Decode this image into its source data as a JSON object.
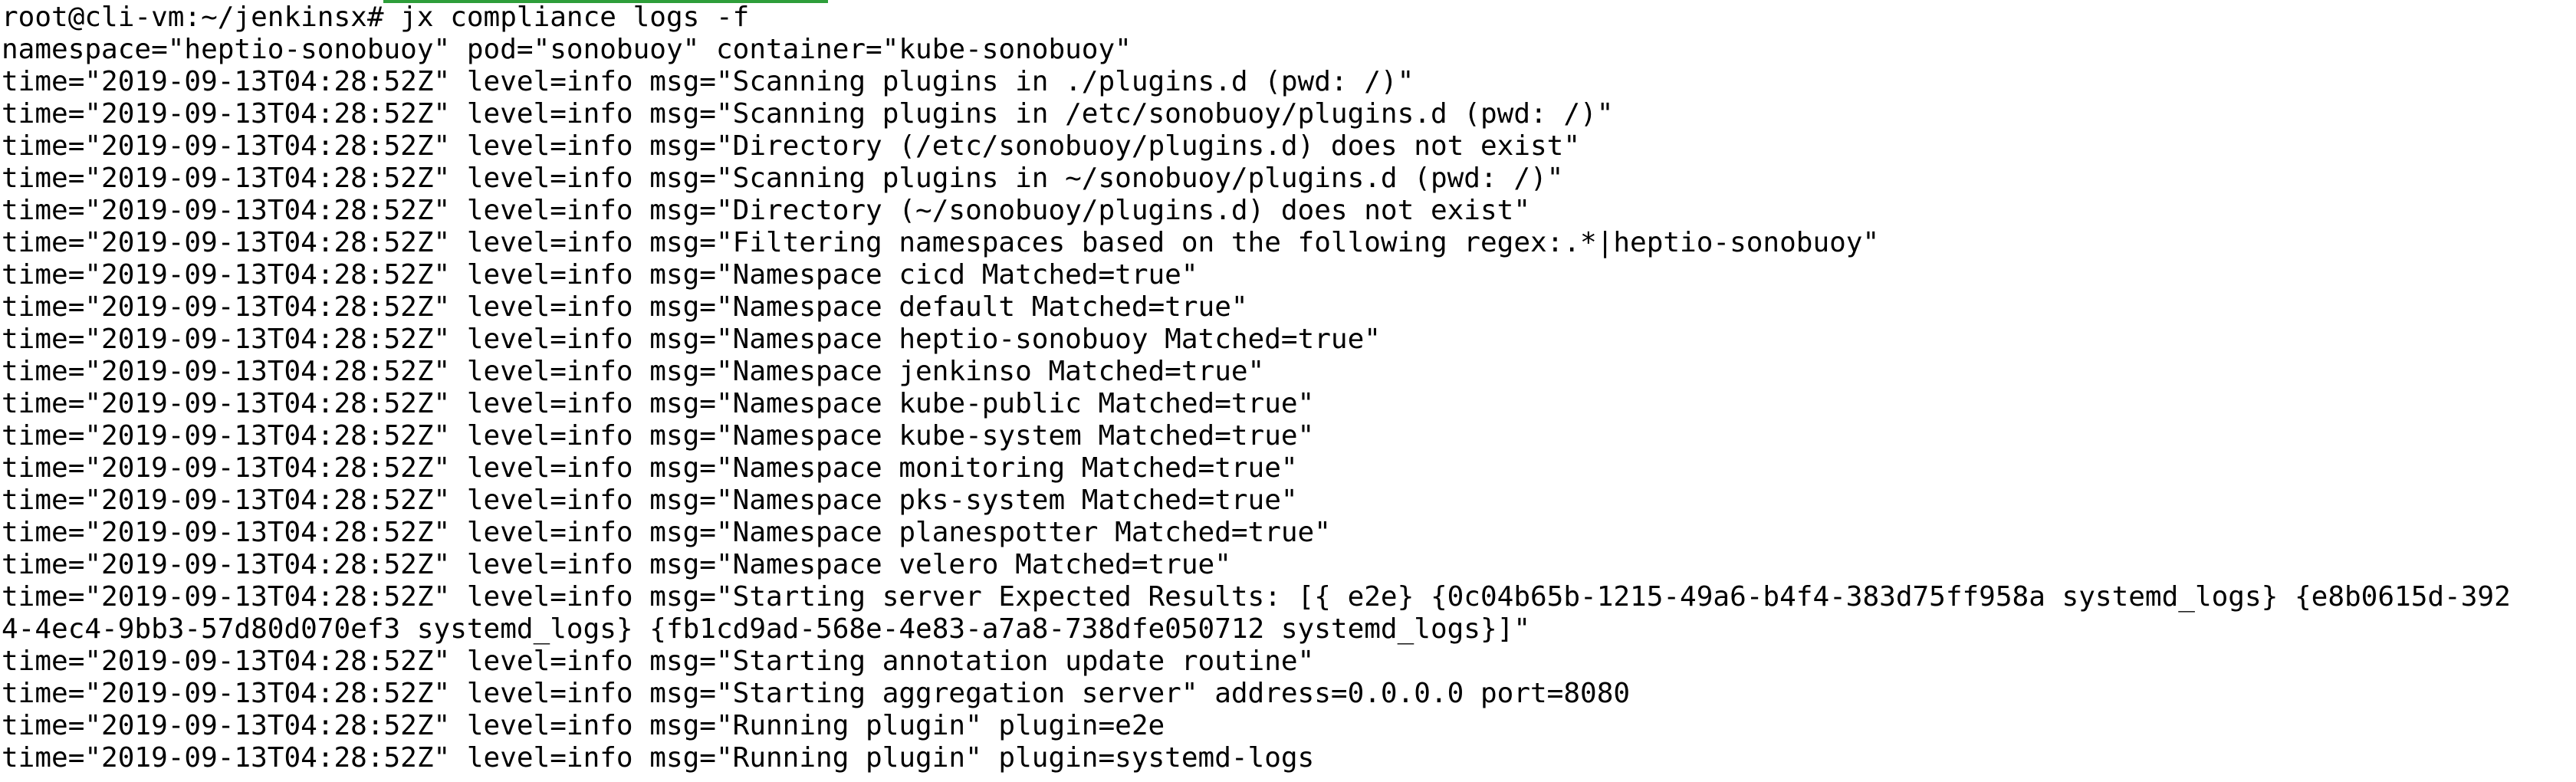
{
  "terminal": {
    "background": "#ffffff",
    "foreground": "#000000",
    "accent": "#2e9e3a",
    "lines": [
      "root@cli-vm:~/jenkinsx# jx compliance logs -f",
      "namespace=\"heptio-sonobuoy\" pod=\"sonobuoy\" container=\"kube-sonobuoy\"",
      "time=\"2019-09-13T04:28:52Z\" level=info msg=\"Scanning plugins in ./plugins.d (pwd: /)\"",
      "time=\"2019-09-13T04:28:52Z\" level=info msg=\"Scanning plugins in /etc/sonobuoy/plugins.d (pwd: /)\"",
      "time=\"2019-09-13T04:28:52Z\" level=info msg=\"Directory (/etc/sonobuoy/plugins.d) does not exist\"",
      "time=\"2019-09-13T04:28:52Z\" level=info msg=\"Scanning plugins in ~/sonobuoy/plugins.d (pwd: /)\"",
      "time=\"2019-09-13T04:28:52Z\" level=info msg=\"Directory (~/sonobuoy/plugins.d) does not exist\"",
      "time=\"2019-09-13T04:28:52Z\" level=info msg=\"Filtering namespaces based on the following regex:.*|heptio-sonobuoy\"",
      "time=\"2019-09-13T04:28:52Z\" level=info msg=\"Namespace cicd Matched=true\"",
      "time=\"2019-09-13T04:28:52Z\" level=info msg=\"Namespace default Matched=true\"",
      "time=\"2019-09-13T04:28:52Z\" level=info msg=\"Namespace heptio-sonobuoy Matched=true\"",
      "time=\"2019-09-13T04:28:52Z\" level=info msg=\"Namespace jenkinso Matched=true\"",
      "time=\"2019-09-13T04:28:52Z\" level=info msg=\"Namespace kube-public Matched=true\"",
      "time=\"2019-09-13T04:28:52Z\" level=info msg=\"Namespace kube-system Matched=true\"",
      "time=\"2019-09-13T04:28:52Z\" level=info msg=\"Namespace monitoring Matched=true\"",
      "time=\"2019-09-13T04:28:52Z\" level=info msg=\"Namespace pks-system Matched=true\"",
      "time=\"2019-09-13T04:28:52Z\" level=info msg=\"Namespace planespotter Matched=true\"",
      "time=\"2019-09-13T04:28:52Z\" level=info msg=\"Namespace velero Matched=true\"",
      "time=\"2019-09-13T04:28:52Z\" level=info msg=\"Starting server Expected Results: [{ e2e} {0c04b65b-1215-49a6-b4f4-383d75ff958a systemd_logs} {e8b0615d-392",
      "4-4ec4-9bb3-57d80d070ef3 systemd_logs} {fb1cd9ad-568e-4e83-a7a8-738dfe050712 systemd_logs}]\"",
      "time=\"2019-09-13T04:28:52Z\" level=info msg=\"Starting annotation update routine\"",
      "time=\"2019-09-13T04:28:52Z\" level=info msg=\"Starting aggregation server\" address=0.0.0.0 port=8080",
      "time=\"2019-09-13T04:28:52Z\" level=info msg=\"Running plugin\" plugin=e2e",
      "time=\"2019-09-13T04:28:52Z\" level=info msg=\"Running plugin\" plugin=systemd-logs"
    ]
  }
}
